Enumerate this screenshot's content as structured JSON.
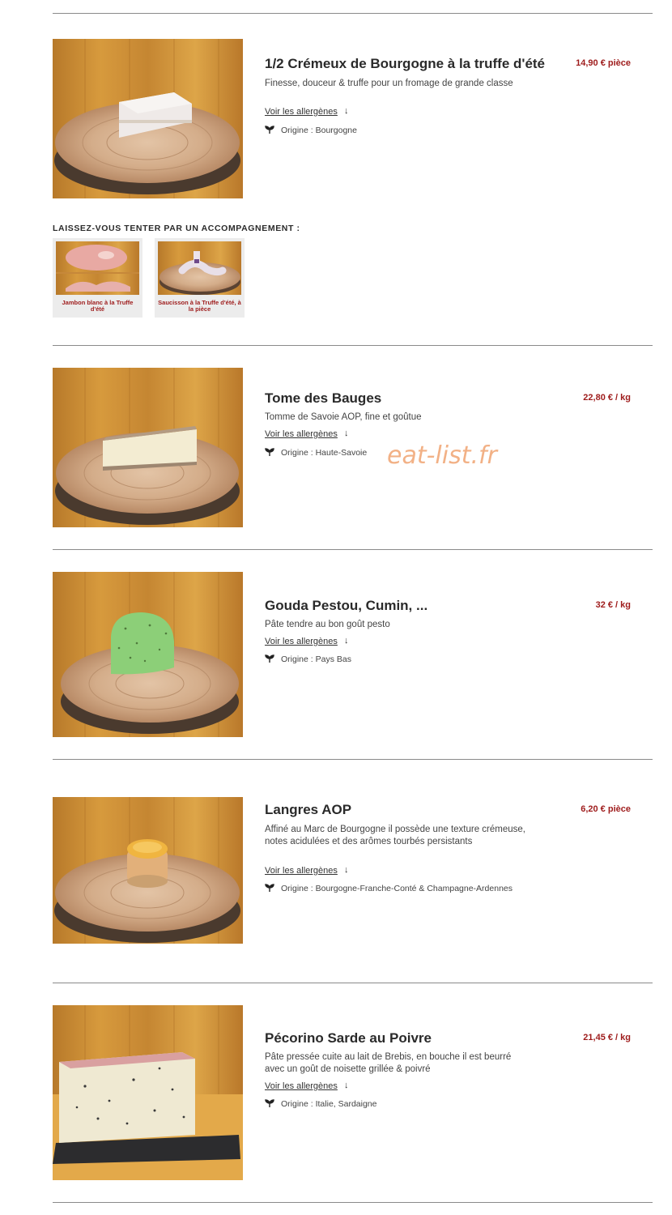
{
  "allergen_link_label": "Voir les allergènes",
  "arrow_glyph": "↓",
  "colors": {
    "price": "#9e1b1b",
    "divider": "#8a8a8a",
    "card_bg": "#ececec",
    "watermark": "#f2b186"
  },
  "products": [
    {
      "name": "1/2 Crémeux de Bourgogne à la truffe d'été",
      "price": "14,90 € pièce",
      "description": "Finesse, douceur & truffe pour un fromage de grande classe",
      "origin": "Origine : Bourgogne",
      "icon": "leaf-icon"
    },
    {
      "name": "Tome des Bauges",
      "price": "22,80 € / kg",
      "description": "Tomme de Savoie AOP, fine et goûtue",
      "origin": "Origine : Haute-Savoie",
      "icon": "leaf-icon"
    },
    {
      "name": "Gouda Pestou, Cumin, ...",
      "price": "32 € / kg",
      "description": "Pâte tendre au bon goût pesto",
      "origin": "Origine : Pays Bas",
      "icon": "leaf-icon"
    },
    {
      "name": "Langres AOP",
      "price": "6,20 € pièce",
      "description": "Affiné au Marc de Bourgogne il possède une texture crémeuse, notes acidulées et des arômes tourbés persistants",
      "origin": "Origine : Bourgogne-Franche-Conté & Champagne-Ardennes",
      "icon": "leaf-icon"
    },
    {
      "name": "Pécorino Sarde au Poivre",
      "price": "21,45 € / kg",
      "description": "Pâte pressée cuite au lait de Brebis, en bouche il est beurré avec un goût de noisette grillée & poivré",
      "origin": "Origine : Italie, Sardaigne",
      "icon": "leaf-icon"
    }
  ],
  "accompaniment": {
    "title": "LAISSEZ-VOUS TENTER PAR UN ACCOMPAGNEMENT :",
    "items": [
      {
        "label": "Jambon blanc à la Truffe d'été"
      },
      {
        "label": "Saucisson à la Truffe d'été, à la pièce"
      }
    ]
  },
  "watermark": "eat-list.fr"
}
